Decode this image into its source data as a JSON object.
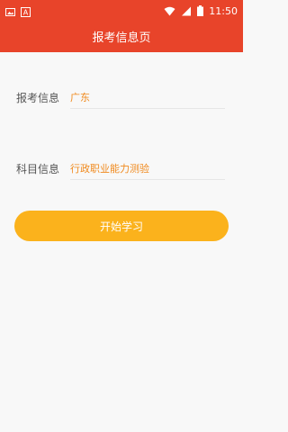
{
  "status_bar": {
    "time": "11:50",
    "icons": [
      "image-icon",
      "a-box-icon",
      "wifi-icon",
      "signal-icon",
      "battery-icon"
    ]
  },
  "header": {
    "title": "报考信息页"
  },
  "form": {
    "exam_label": "报考信息",
    "exam_value": "广东",
    "subject_label": "科目信息",
    "subject_value": "行政职业能力测验"
  },
  "actions": {
    "start_label": "开始学习"
  },
  "colors": {
    "accent": "#e8442a",
    "value": "#f08a1e",
    "button": "#fbb21c"
  }
}
